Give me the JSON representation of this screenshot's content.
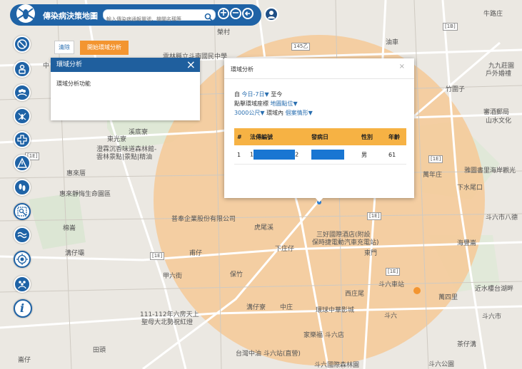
{
  "app": {
    "title": "傳染病決策地圖",
    "search_placeholder": "輸入傳染病通報單號、機關名稱等"
  },
  "colors": {
    "primary": "#1f63a6",
    "accent": "#f39530",
    "table_header": "#f6b244",
    "radius_fill": "#f6c996"
  },
  "icons": {
    "search": "search-icon",
    "zoom_in": "plus-circle-icon",
    "zoom_out": "minus-circle-icon",
    "back": "arrow-left-circle-icon",
    "user": "user-icon"
  },
  "sidebar": {
    "items": [
      {
        "name": "sidebar-item-layers",
        "icon": "no-bacteria-icon"
      },
      {
        "name": "sidebar-item-person",
        "icon": "person-icon"
      },
      {
        "name": "sidebar-item-group",
        "icon": "group-icon"
      },
      {
        "name": "sidebar-item-mosquito",
        "icon": "mosquito-icon"
      },
      {
        "name": "sidebar-item-medical",
        "icon": "medical-cross-icon"
      },
      {
        "name": "sidebar-item-warning",
        "icon": "warning-icon"
      },
      {
        "name": "sidebar-item-footprint",
        "icon": "footprint-icon"
      },
      {
        "name": "sidebar-item-search-area",
        "icon": "area-search-icon"
      },
      {
        "name": "sidebar-item-water",
        "icon": "water-icon"
      },
      {
        "name": "sidebar-item-target",
        "icon": "target-icon"
      },
      {
        "name": "sidebar-item-people",
        "icon": "people-icon"
      },
      {
        "name": "sidebar-item-info",
        "icon": "info-icon"
      }
    ]
  },
  "panel": {
    "title": "環域分析",
    "description": "環域分析功能",
    "clear_label": "清除",
    "start_label": "開始環域分析"
  },
  "popup": {
    "title": "環域分析",
    "close": "×",
    "from_prefix": "自",
    "from_value": "今日-7日▼",
    "to_label": "至今",
    "point_label": "點擊環域座標",
    "point_value": "地圖點位▼",
    "distance_value": "3000公尺▼",
    "within_label": "環域內",
    "case_value": "個案情形▼",
    "table": {
      "headers": [
        "#",
        "法傳編號",
        "發病日",
        "性別",
        "年齡"
      ],
      "rows": [
        {
          "num": "1",
          "id_prefix": "1",
          "id_suffix": "2",
          "onset": "",
          "sex": "男",
          "age": "61"
        }
      ]
    }
  },
  "map_labels": [
    {
      "text": "榮村"
    },
    {
      "text": "油車"
    },
    {
      "text": "中"
    },
    {
      "text": "雲林縣立斗南國民中學"
    },
    {
      "text": "九九莊園"
    },
    {
      "text": "戶外婚禮"
    },
    {
      "text": "竹圍子"
    },
    {
      "text": "審酒郵局"
    },
    {
      "text": "山水文化"
    },
    {
      "text": "溪底寮"
    },
    {
      "text": "東光寮"
    },
    {
      "text": "澄霖沉香味道森林館-"
    },
    {
      "text": "雲林景點|景點|精油"
    },
    {
      "text": "惠來厝"
    },
    {
      "text": "萬年庄"
    },
    {
      "text": "雅圖書里海岸觀光"
    },
    {
      "text": "下水尾口"
    },
    {
      "text": "惠來靜悔生命園區"
    },
    {
      "text": "斗六市八德"
    },
    {
      "text": "普奉企業股份有限公司"
    },
    {
      "text": "虎尾溪"
    },
    {
      "text": "三好國際酒店(附設"
    },
    {
      "text": "保時捷電動汽車充電站)"
    },
    {
      "text": "海豐崙"
    },
    {
      "text": "下庄仔"
    },
    {
      "text": "溝仔壩"
    },
    {
      "text": "棉崙"
    },
    {
      "text": "甫仔"
    },
    {
      "text": "東門"
    },
    {
      "text": "甲六街"
    },
    {
      "text": "保竹"
    },
    {
      "text": "西庄尾"
    },
    {
      "text": "斗六車站"
    },
    {
      "text": "萬四里"
    },
    {
      "text": "近水樓台湖畔"
    },
    {
      "text": "斗六市"
    },
    {
      "text": "111-112年六房天上"
    },
    {
      "text": "聖母大北勢祝紅燈"
    },
    {
      "text": "溝仔寮"
    },
    {
      "text": "中庄"
    },
    {
      "text": "環球中華影城"
    },
    {
      "text": "斗六"
    },
    {
      "text": "家樂福 斗六店"
    },
    {
      "text": "台灣中油 斗六站(直營)"
    },
    {
      "text": "茶仔溝"
    },
    {
      "text": "田頭"
    },
    {
      "text": "崙仔"
    },
    {
      "text": "斗六國際森林園"
    },
    {
      "text": "斗六公園"
    },
    {
      "text": "牛路庄"
    }
  ],
  "road_numbers": [
    {
      "text": "145乙"
    },
    {
      "text": "[1B]"
    },
    {
      "text": "[1E]"
    },
    {
      "text": "[1E]"
    },
    {
      "text": "[1E]"
    },
    {
      "text": "[1E]"
    },
    {
      "text": "[1E]"
    }
  ]
}
